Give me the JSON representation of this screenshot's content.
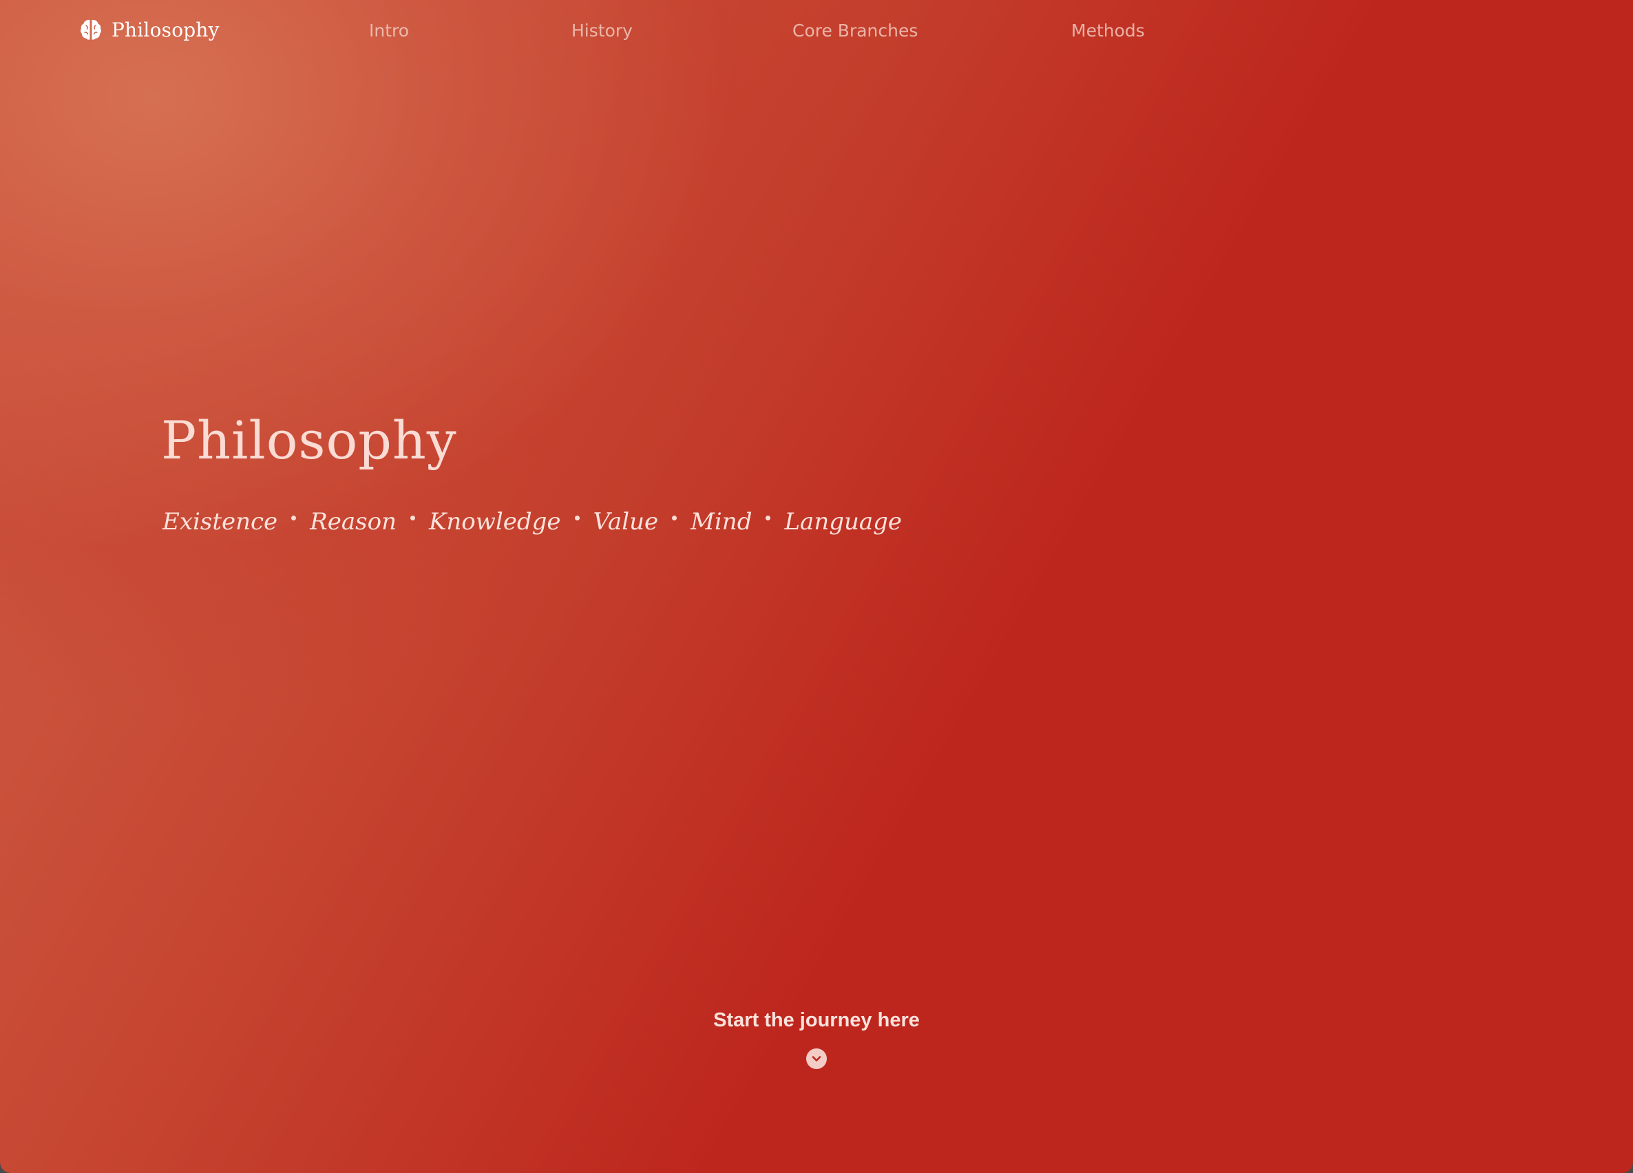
{
  "theme": {
    "accent": "#bd261d",
    "highlight": "#d0634a",
    "text_light": "#fce2dc"
  },
  "brand": {
    "label": "Philosophy",
    "icon": "brain-icon"
  },
  "nav": {
    "items": [
      {
        "label": "Intro"
      },
      {
        "label": "History"
      },
      {
        "label": "Core Branches"
      },
      {
        "label": "Methods"
      }
    ]
  },
  "hero": {
    "title": "Philosophy",
    "tags": [
      "Existence",
      "Reason",
      "Knowledge",
      "Value",
      "Mind",
      "Language"
    ]
  },
  "cta": {
    "label": "Start the journey here",
    "icon": "chevron-down-circle-icon"
  }
}
